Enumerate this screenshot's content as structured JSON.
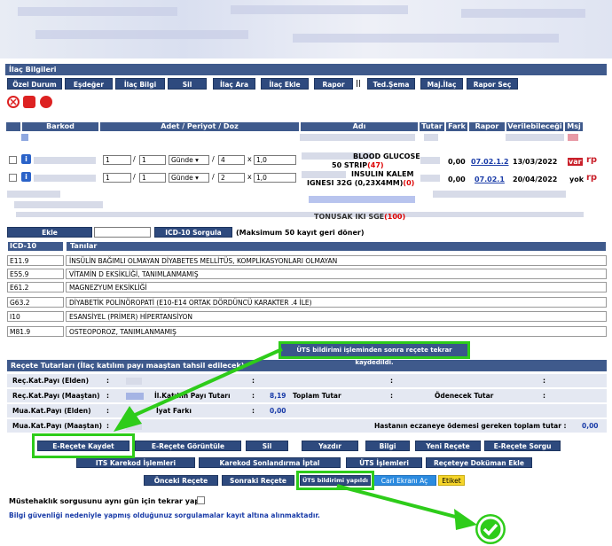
{
  "section_title": "İlaç Bilgileri",
  "toolbar": [
    "Özel Durum",
    "Eşdeğer",
    "İlaç Bilgi",
    "Sil",
    "İlaç Ara",
    "İlaç Ekle",
    "Rapor",
    "Ted.Şema",
    "Maj.İlaç",
    "Rapor Seç"
  ],
  "toolbar_separator": "||",
  "table_headers": {
    "barkod": "Barkod",
    "adet": "Adet / Periyot / Doz",
    "adi": "Adı",
    "tutar": "Tutar",
    "fark": "Fark",
    "rapor": "Rapor",
    "verilebilecegi": "Verilebileceği",
    "msj": "Msj"
  },
  "drugs": [
    {
      "adet": "1",
      "periyot": "1",
      "birim": "Günde",
      "carpan": "4",
      "doz": "1,0",
      "name_line1": "BLOOD GLUCOSE",
      "name_line2": "50 STRIP",
      "count": "(47)",
      "fark": "0,00",
      "rapor": "07.02.1.2",
      "tarih": "13/03/2022",
      "msj": "var"
    },
    {
      "adet": "1",
      "periyot": "1",
      "birim": "Günde",
      "carpan": "2",
      "doz": "1,0",
      "name_line1": "INSULIN KALEM",
      "name_line2": "IGNESI 32G (0,23X4MM)",
      "count": "(0)",
      "fark": "0,00",
      "rapor": "07.02.1",
      "tarih": "20/04/2022",
      "msj": "yok"
    }
  ],
  "partial_name": "TONUSAK IKI SGE",
  "partial_count": "(100)",
  "ekle_label": "Ekle",
  "icd_sorgula": "ICD-10 Sorgula",
  "icd_note": "(Maksimum 50 kayıt geri döner)",
  "icd_headers": {
    "code": "ICD-10",
    "name": "Tanılar"
  },
  "icd": [
    {
      "code": "E11.9",
      "name": "İNSÜLİN BAĞIMLI OLMAYAN DİYABETES MELLİTÜS, KOMPLİKASYONLARI OLMAYAN"
    },
    {
      "code": "E55.9",
      "name": "VİTAMİN D EKSİKLİĞİ, TANIMLANMAMIŞ"
    },
    {
      "code": "E61.2",
      "name": "MAGNEZYUM EKSİKLİĞİ"
    },
    {
      "code": "G63.2",
      "name": "DİYABETİK POLİNÖROPATİ (E10-E14 ORTAK DÖRDÜNCÜ KARAKTER .4 İLE)"
    },
    {
      "code": "I10",
      "name": "ESANSİYEL (PRİMER) HİPERTANSİYON"
    },
    {
      "code": "M81.9",
      "name": "OSTEOPOROZ, TANIMLANMAMIŞ"
    }
  ],
  "tooltip": "ÜTS bildirimi işleminden sonra reçete tekrar kaydedildi.",
  "recete_title": "Reçete Tutarları (İlaç katılım payı maaştan tahsil edilecek)",
  "sum": {
    "r1": "Reç.Kat.Payı (Elden)",
    "r2": "Reç.Kat.Payı (Maaştan)",
    "r2b": "İl.Katılım Payı Tutarı",
    "r2b_val": "8,19",
    "r2c": "Toplam Tutar",
    "r2d": "Ödenecek Tutar",
    "r3": "Mua.Kat.Payı (Elden)",
    "r3b": "İyat Farkı",
    "r3b_val": "0,00",
    "r4": "Mua.Kat.Payı (Maaştan)",
    "r4b": "Hastanın eczaneye ödemesi gereken toplam tutar :",
    "r4b_val": "0,00",
    "colon": ":"
  },
  "actions_row1": [
    "E-Reçete Kaydet",
    "E-Reçete Görüntüle",
    "Sil",
    "Yazdır",
    "Bilgi",
    "Yeni Reçete",
    "E-Reçete Sorgu"
  ],
  "actions_row2": [
    "ITS Karekod İşlemleri",
    "Karekod Sonlandırma İptal",
    "ÜTS İşlemleri",
    "Reçeteye Doküman Ekle"
  ],
  "actions_row3": [
    "Önceki Reçete",
    "Sonraki Reçete",
    "ÜTS bildirimi yapıldı",
    "Cari Ekranı Aç",
    "Etiket"
  ],
  "muste_label": "Müstehaklık sorgusunu aynı gün için tekrar yap :",
  "footer_note": "Bilgi güvenliği nedeniyle yapmış olduğunuz sorgulamalar kayıt altına alınmaktadır.",
  "colors": {
    "header": "#3f5a8c",
    "button": "#2e4a7e",
    "highlight": "#2ecc1a"
  }
}
